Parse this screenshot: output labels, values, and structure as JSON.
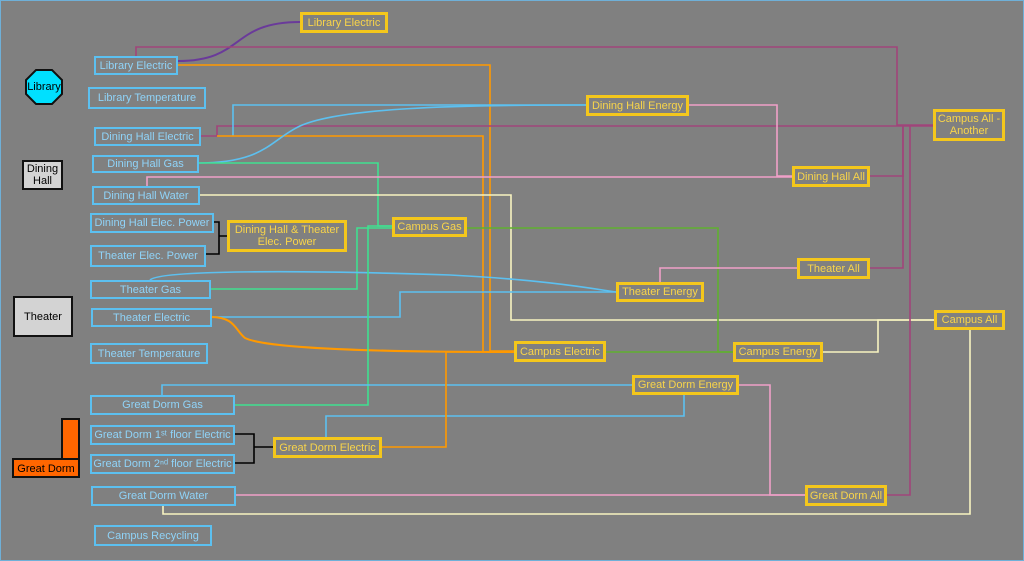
{
  "buildings": {
    "library": "Library",
    "dining_hall": "Dining Hall",
    "theater": "Theater",
    "great_dorm": "Great Dorm"
  },
  "sources": {
    "library_electric": "Library Electric",
    "library_temperature": "Library Temperature",
    "dining_hall_electric": "Dining Hall Electric",
    "dining_hall_gas": "Dining Hall Gas",
    "dining_hall_water": "Dining Hall Water",
    "dining_hall_elec_power": "Dining Hall Elec. Power",
    "theater_elec_power": "Theater Elec. Power",
    "theater_gas": "Theater Gas",
    "theater_electric": "Theater Electric",
    "theater_temperature": "Theater Temperature",
    "great_dorm_gas": "Great Dorm Gas",
    "great_dorm_1st_floor_electric": "Great Dorm 1ˢᵗ floor Electric",
    "great_dorm_2nd_floor_electric": "Great Dorm 2ⁿᵈ floor Electric",
    "great_dorm_water": "Great Dorm Water",
    "campus_recycling": "Campus Recycling"
  },
  "aggregates": {
    "library_electric": "Library Electric",
    "dining_hall_theater_elec_power": "Dining Hall & Theater Elec. Power",
    "campus_gas": "Campus Gas",
    "dining_hall_energy": "Dining Hall Energy",
    "dining_hall_all": "Dining Hall All",
    "campus_all_another": "Campus All - Another",
    "theater_all": "Theater All",
    "theater_energy": "Theater Energy",
    "campus_all": "Campus All",
    "campus_electric": "Campus Electric",
    "campus_energy": "Campus Energy",
    "great_dorm_energy": "Great Dorm Energy",
    "great_dorm_electric": "Great Dorm Electric",
    "great_dorm_all": "Great Dorm All"
  },
  "colors": {
    "source_border": "#5cc0f0",
    "aggregate_border": "#f4c71c",
    "library": "#00e0ff",
    "great_dorm": "#ff6600",
    "electric": "#ff9900",
    "gas": "#40e090",
    "water": "#f8f4c0",
    "all": "#a0457a",
    "energy": "#f0a0c8",
    "campus_gas": "#60b030",
    "blue": "#5cc0f0",
    "library_link": "#6a3a9a"
  }
}
